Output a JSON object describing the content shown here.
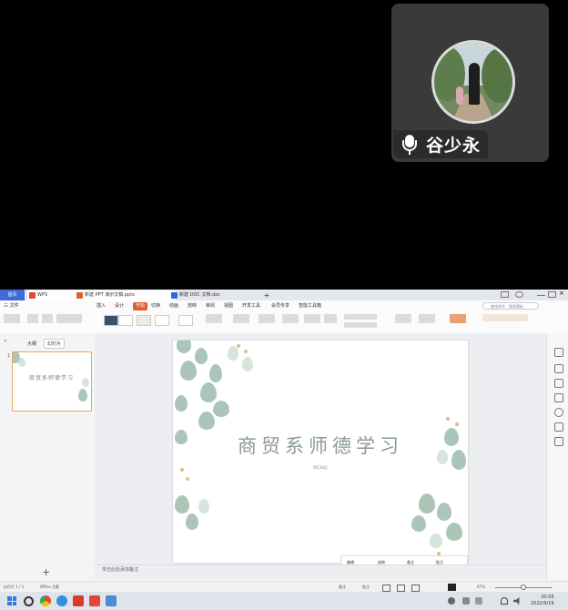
{
  "participant": {
    "name": "谷少永"
  },
  "shared_screen": {
    "tabs": [
      {
        "label": "首页"
      },
      {
        "label": "WPS"
      },
      {
        "label": "新建 PPT 演示文稿.pptx"
      },
      {
        "label": "新建 DOC 文档.doc"
      },
      {
        "label": "+"
      }
    ],
    "menu": {
      "items": [
        "三 文件",
        "开始",
        "插入",
        "设计",
        "切换",
        "动画",
        "放映",
        "审阅",
        "视图",
        "开发工具",
        "会员专享",
        "智能工具箱"
      ],
      "search_placeholder": "查找命令、搜索模板"
    },
    "left_pane": {
      "outline_tab": "大纲",
      "slides_tab": "幻灯片",
      "slide_number": "1",
      "thumb_title": "商贸系师德学习",
      "add_slide": "+"
    },
    "slide": {
      "title": "商贸系师德学习",
      "date": "9月16日"
    },
    "float_bar": [
      "编辑",
      "放映",
      "备注",
      "批注"
    ],
    "notes_placeholder": "单击此处添加备注",
    "status": {
      "slide_info": "幻灯片 1 / 1",
      "theme": "Office 主题",
      "notes_toggle": "备注",
      "comment_toggle": "批注",
      "zoom": "67%"
    },
    "taskbar": {
      "time": "20:05",
      "date": "2022/9/16"
    }
  }
}
